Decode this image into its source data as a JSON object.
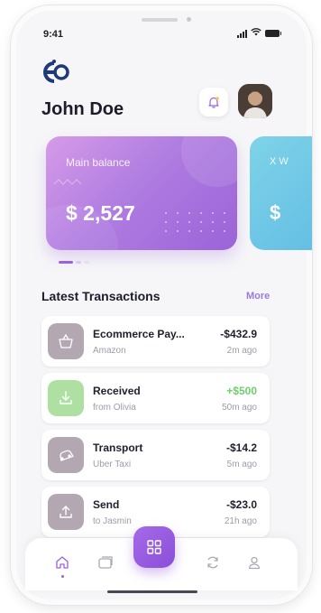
{
  "status_bar": {
    "time": "9:41"
  },
  "header": {
    "user_name": "John Doe"
  },
  "cards": [
    {
      "label": "Main balance",
      "amount": "$ 2,527"
    },
    {
      "label": "X W",
      "amount": "$"
    }
  ],
  "section": {
    "title": "Latest Transactions",
    "more_label": "More"
  },
  "transactions": [
    {
      "title": "Ecommerce Pay...",
      "subtitle": "Amazon",
      "amount": "-$432.9",
      "time": "2m ago",
      "icon": "basket-icon"
    },
    {
      "title": "Received",
      "subtitle": "from Olivia",
      "amount": "+$500",
      "time": "50m ago",
      "icon": "download-icon"
    },
    {
      "title": "Transport",
      "subtitle": "Uber Taxi",
      "amount": "-$14.2",
      "time": "5m ago",
      "icon": "car-icon"
    },
    {
      "title": "Send",
      "subtitle": "to Jasmin",
      "amount": "-$23.0",
      "time": "21h ago",
      "icon": "upload-icon"
    }
  ],
  "nav": {
    "items": [
      "home-icon",
      "cards-icon",
      "grid-icon",
      "refresh-icon",
      "profile-icon"
    ],
    "active": "home-icon"
  },
  "colors": {
    "accent": "#9a63d8",
    "positive": "#6fce6f",
    "card_purple": "#b07de1",
    "card_cyan": "#64bfe4"
  }
}
